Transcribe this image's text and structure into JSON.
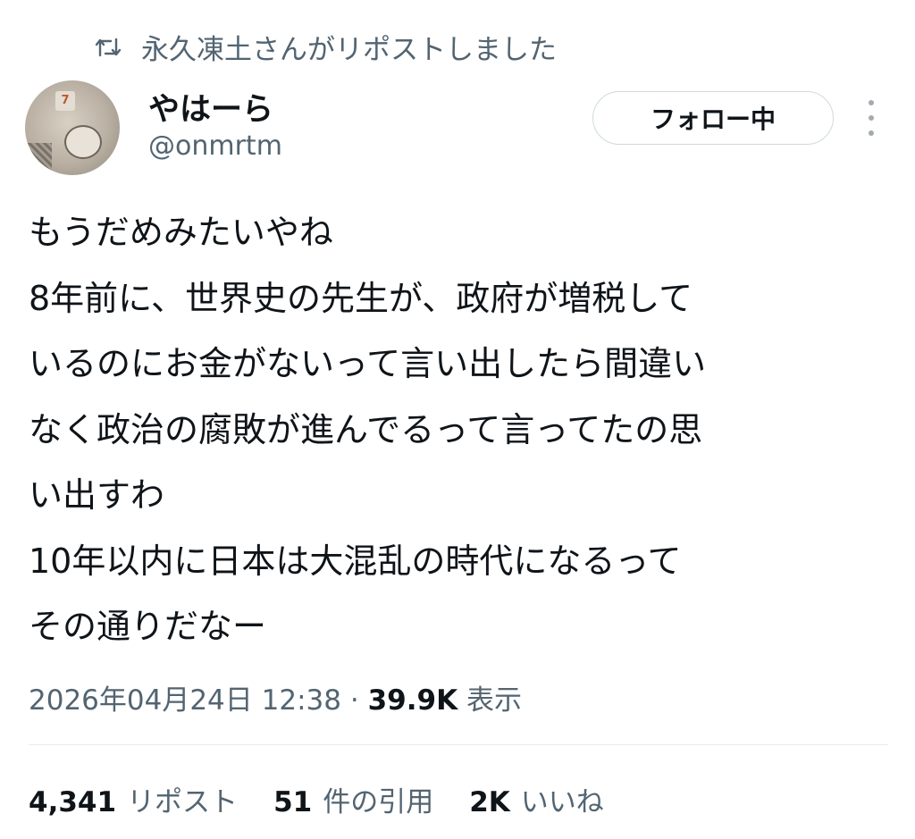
{
  "repost_context": {
    "icon": "retweet-icon",
    "text": "永久凍土さんがリポストしました"
  },
  "author": {
    "display_name": "やはーら",
    "handle": "@onmrtm",
    "avatar_mark": "7"
  },
  "follow_button": {
    "label": "フォロー中"
  },
  "tweet": {
    "lines": [
      "もうだめみたいやね",
      "8年前に、世界史の先生が、政府が増税して",
      "いるのにお金がないって言い出したら間違い",
      "なく政治の腐敗が進んでるって言ってたの思",
      "い出すわ",
      "10年以内に日本は大混乱の時代になるって",
      "その通りだなー"
    ]
  },
  "meta": {
    "date": "2026年04月24日",
    "time": "12:38",
    "separator": "·",
    "views_count": "39.9K",
    "views_label": "表示"
  },
  "stats": {
    "reposts": {
      "count": "4,341",
      "label": "リポスト"
    },
    "quotes": {
      "count": "51",
      "label": "件の引用"
    },
    "likes": {
      "count": "2K",
      "label": "いいね"
    }
  },
  "colors": {
    "text_primary": "#0f1419",
    "text_secondary": "#536471",
    "border": "#cfd9de"
  }
}
